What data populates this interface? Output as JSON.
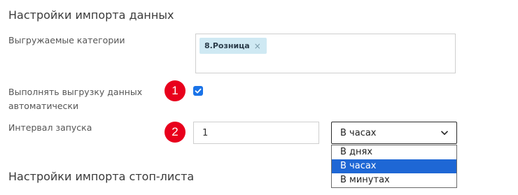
{
  "import_settings": {
    "title": "Настройки импорта данных",
    "categories_label": "Выгружаемые категории",
    "categories_tags": [
      {
        "label": "8.Розница",
        "remove": "×"
      }
    ],
    "auto_export_label": "Выполнять выгрузку данных автоматически",
    "auto_export_checked": true,
    "interval_label": "Интервал запуска",
    "interval_value": "1",
    "interval_unit_selected": "В часах",
    "interval_unit_options": [
      "В днях",
      "В часах",
      "В минутах"
    ]
  },
  "annotations": {
    "badge1": "1",
    "badge2": "2"
  },
  "stoplist_settings": {
    "title": "Настройки импорта стоп-листа"
  },
  "colors": {
    "accent": "#1e67d5",
    "badge": "#e8001c",
    "tag_bg": "#cfe9f3"
  }
}
